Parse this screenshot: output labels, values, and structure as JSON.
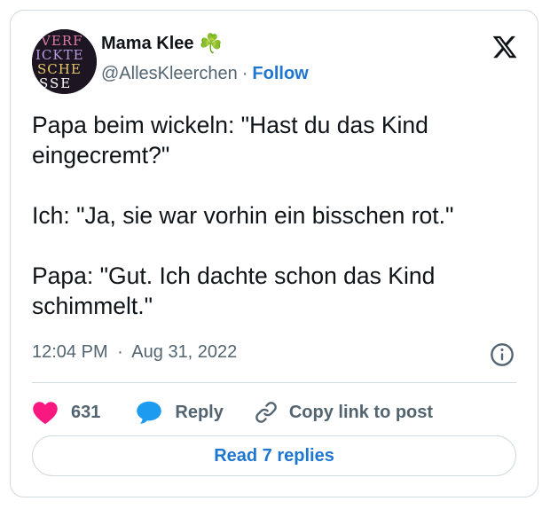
{
  "user": {
    "display_name": "Mama Klee",
    "emoji": "☘️",
    "handle": "@AllesKleerchen",
    "separator": "·",
    "follow_label": "Follow",
    "avatar_text": [
      "VERF",
      "ICKTE",
      "SCHE",
      "SSE"
    ]
  },
  "tweet": {
    "text": "Papa beim wickeln: \"Hast du das Kind eingecremt?\"\n\nIch: \"Ja, sie war vorhin ein bisschen rot.\"\n\nPapa: \"Gut. Ich dachte schon das Kind schimmelt.\"",
    "time": "12:04 PM",
    "meta_separator": "·",
    "date": "Aug 31, 2022"
  },
  "actions": {
    "like_count": "631",
    "reply_label": "Reply",
    "copy_label": "Copy link to post"
  },
  "footer": {
    "read_replies_label": "Read 7 replies"
  },
  "icons": {
    "logo": "x-logo-icon",
    "info": "info-icon",
    "like": "heart-icon",
    "reply": "reply-bubble-icon",
    "copy": "link-icon"
  },
  "colors": {
    "like": "#f91880",
    "reply": "#1d9bf0",
    "accent": "#1d76cf",
    "muted": "#536471",
    "border": "#cfd9de"
  }
}
